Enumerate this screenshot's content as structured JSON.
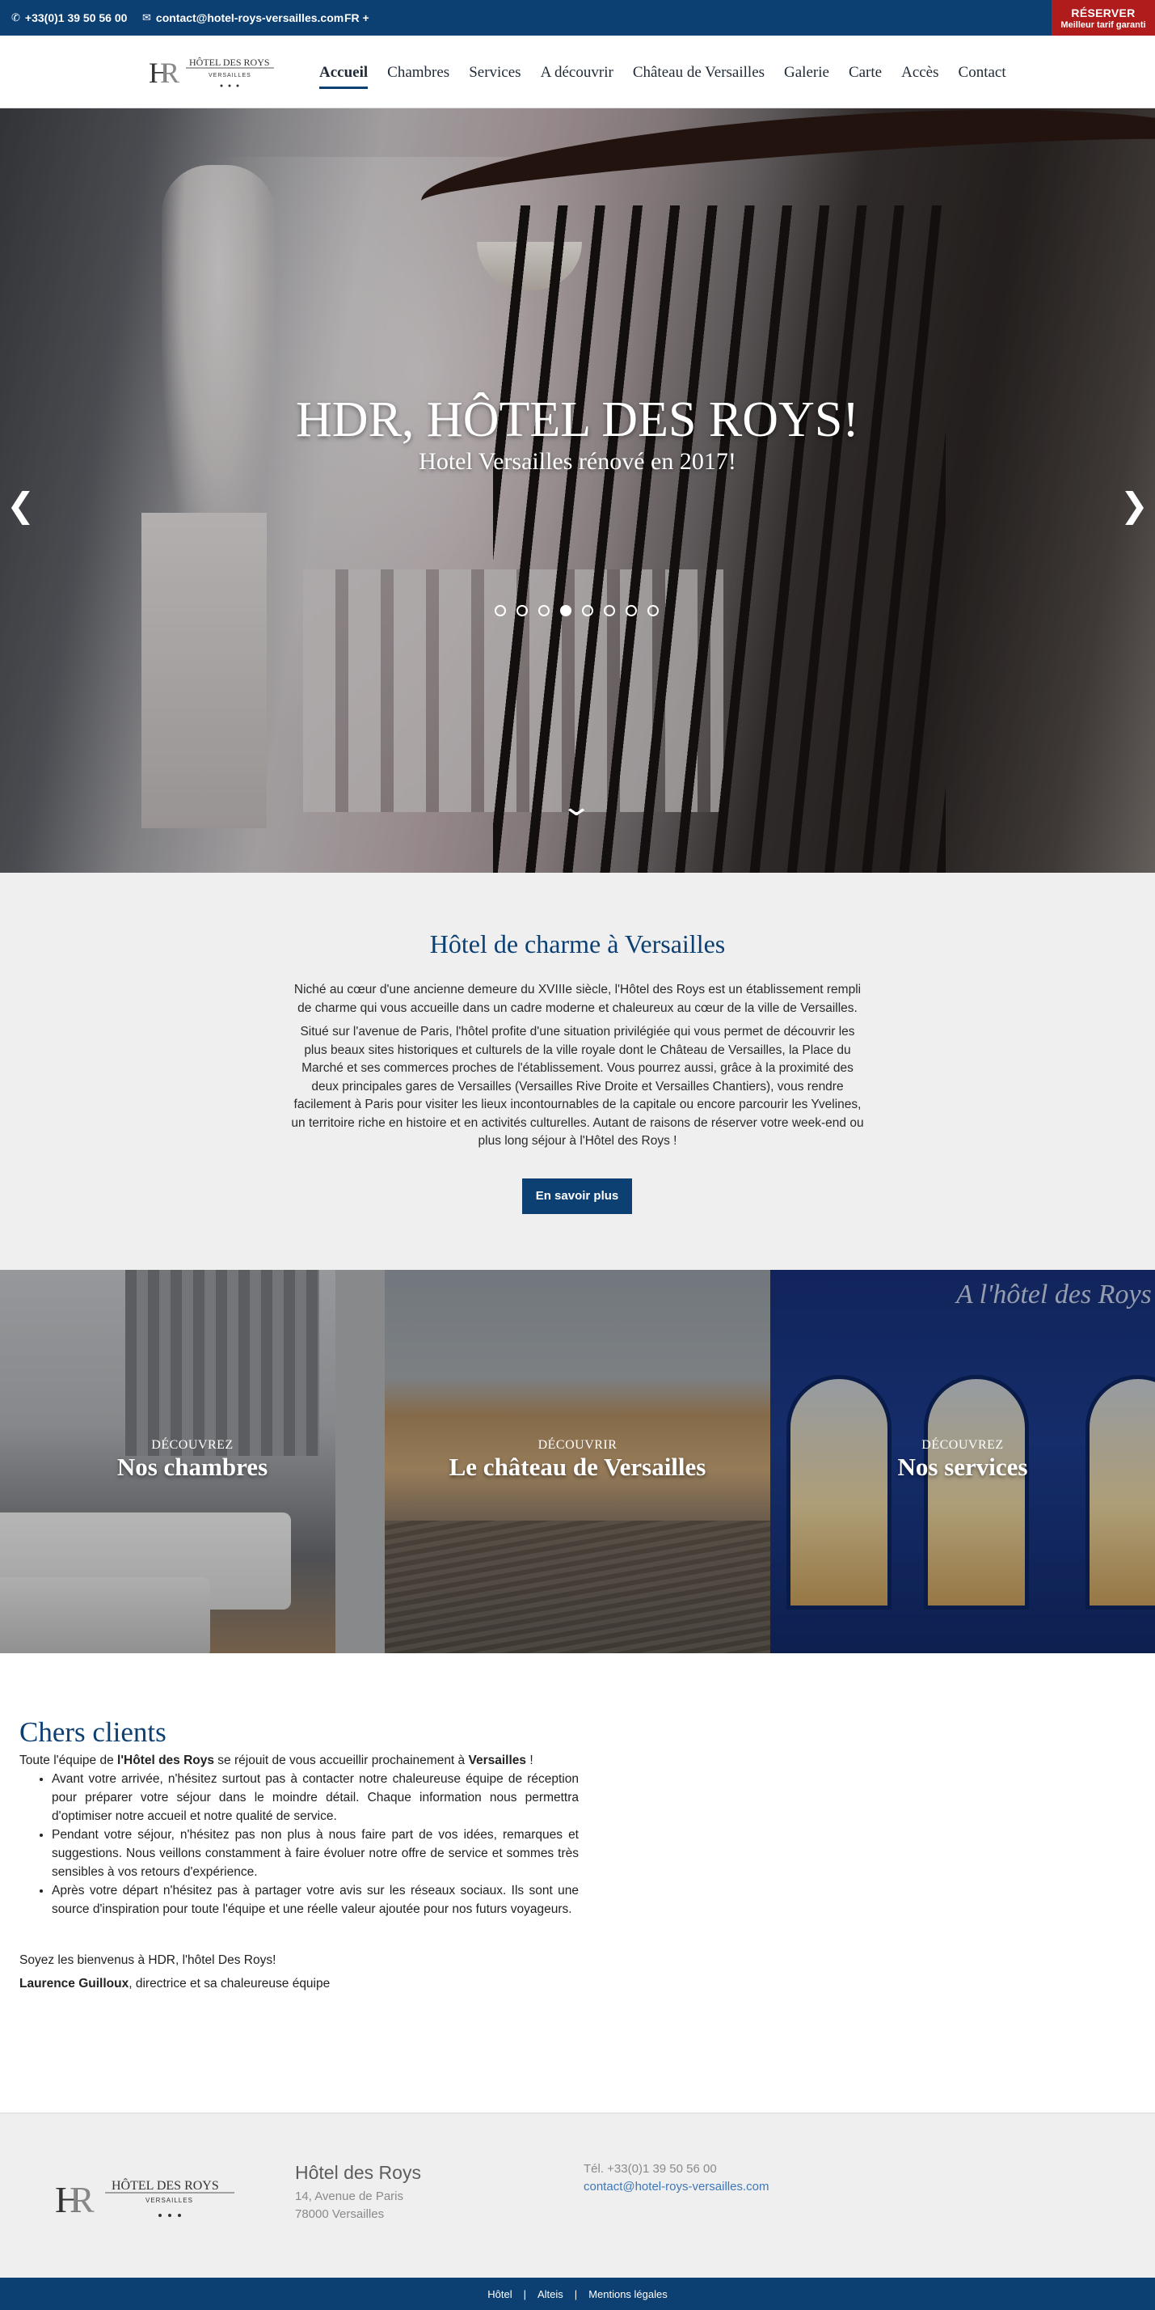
{
  "topbar": {
    "phone": "+33(0)1 39 50 56 00",
    "email": "contact@hotel-roys-versailles.com",
    "language": "FR +",
    "reserve_label": "RÉSERVER",
    "reserve_sub": "Meilleur tarif garanti"
  },
  "logo": {
    "line1": "HÔTEL DES ROYS",
    "line2": "VERSAILLES"
  },
  "nav": {
    "items": [
      "Accueil",
      "Chambres",
      "Services",
      "A découvrir",
      "Château de Versailles",
      "Galerie",
      "Carte",
      "Accès",
      "Contact"
    ],
    "active": "Accueil"
  },
  "hero": {
    "title": "HDR, HÔTEL DES ROYS!",
    "subtitle": "Hotel Versailles rénové en 2017!",
    "slide_count": 8,
    "active_slide": 4
  },
  "intro": {
    "title": "Hôtel de charme à Versailles",
    "p1": "Niché au cœur d'une ancienne demeure du XVIIIe siècle, l'Hôtel des Roys est un établissement rempli de charme qui vous accueille dans un cadre moderne et chaleureux au cœur de la ville de Versailles.",
    "p2": "Situé sur l'avenue de Paris, l'hôtel profite d'une situation privilégiée qui vous permet de découvrir les plus beaux sites historiques et culturels de la ville royale dont le Château de Versailles, la Place du Marché et ses commerces proches de l'établissement. Vous pourrez aussi, grâce à la proximité des deux principales gares de Versailles (Versailles Rive Droite et Versailles Chantiers), vous rendre facilement à Paris pour visiter les lieux incontournables de la capitale ou encore parcourir les Yvelines, un territoire riche en histoire et en activités culturelles. Autant de raisons de réserver votre week-end ou plus long séjour à l'Hôtel des Roys !",
    "button": "En savoir plus"
  },
  "tiles": [
    {
      "kicker": "DÉCOUVREZ",
      "name": "Nos chambres"
    },
    {
      "kicker": "DÉCOUVRIR",
      "name": "Le château de Versailles"
    },
    {
      "kicker": "DÉCOUVREZ",
      "name": "Nos services"
    }
  ],
  "tile_sign": "A l'hôtel des Roys",
  "clients": {
    "title": "Chers clients",
    "intro_a": "Toute l'équipe de ",
    "intro_b": "l'Hôtel des Roys",
    "intro_c": " se réjouit de vous accueillir prochainement à ",
    "intro_d": "Versailles",
    "intro_e": " !",
    "bullets": [
      "Avant votre arrivée, n'hésitez surtout pas à contacter notre chaleureuse équipe de réception pour préparer votre séjour dans le moindre détail. Chaque information nous permettra d'optimiser notre accueil et notre qualité de service.",
      "Pendant votre séjour, n'hésitez pas non plus à nous faire part de vos idées, remarques et suggestions. Nous veillons constamment à faire évoluer notre offre de service et sommes très sensibles à vos retours d'expérience.",
      "Après votre départ n'hésitez pas à partager votre avis sur les réseaux sociaux. Ils sont une source d'inspiration pour toute l'équipe et une réelle valeur ajoutée pour nos futurs voyageurs."
    ],
    "welcome": "Soyez les bienvenus à HDR, l'hôtel Des Roys!",
    "signature_name": "Laurence Guilloux",
    "signature_rest": ", directrice et sa chaleureuse équipe"
  },
  "footer": {
    "name": "Hôtel des Roys",
    "address1": "14, Avenue de Paris",
    "address2": "78000 Versailles",
    "phone": "Tél. +33(0)1 39 50 56 00",
    "email": "contact@hotel-roys-versailles.com",
    "links": [
      "Hôtel",
      "Alteis",
      "Mentions légales"
    ]
  },
  "colors": {
    "brand": "#0c3f72",
    "reserve": "#b01c1c",
    "footer_bg": "#efefef"
  }
}
